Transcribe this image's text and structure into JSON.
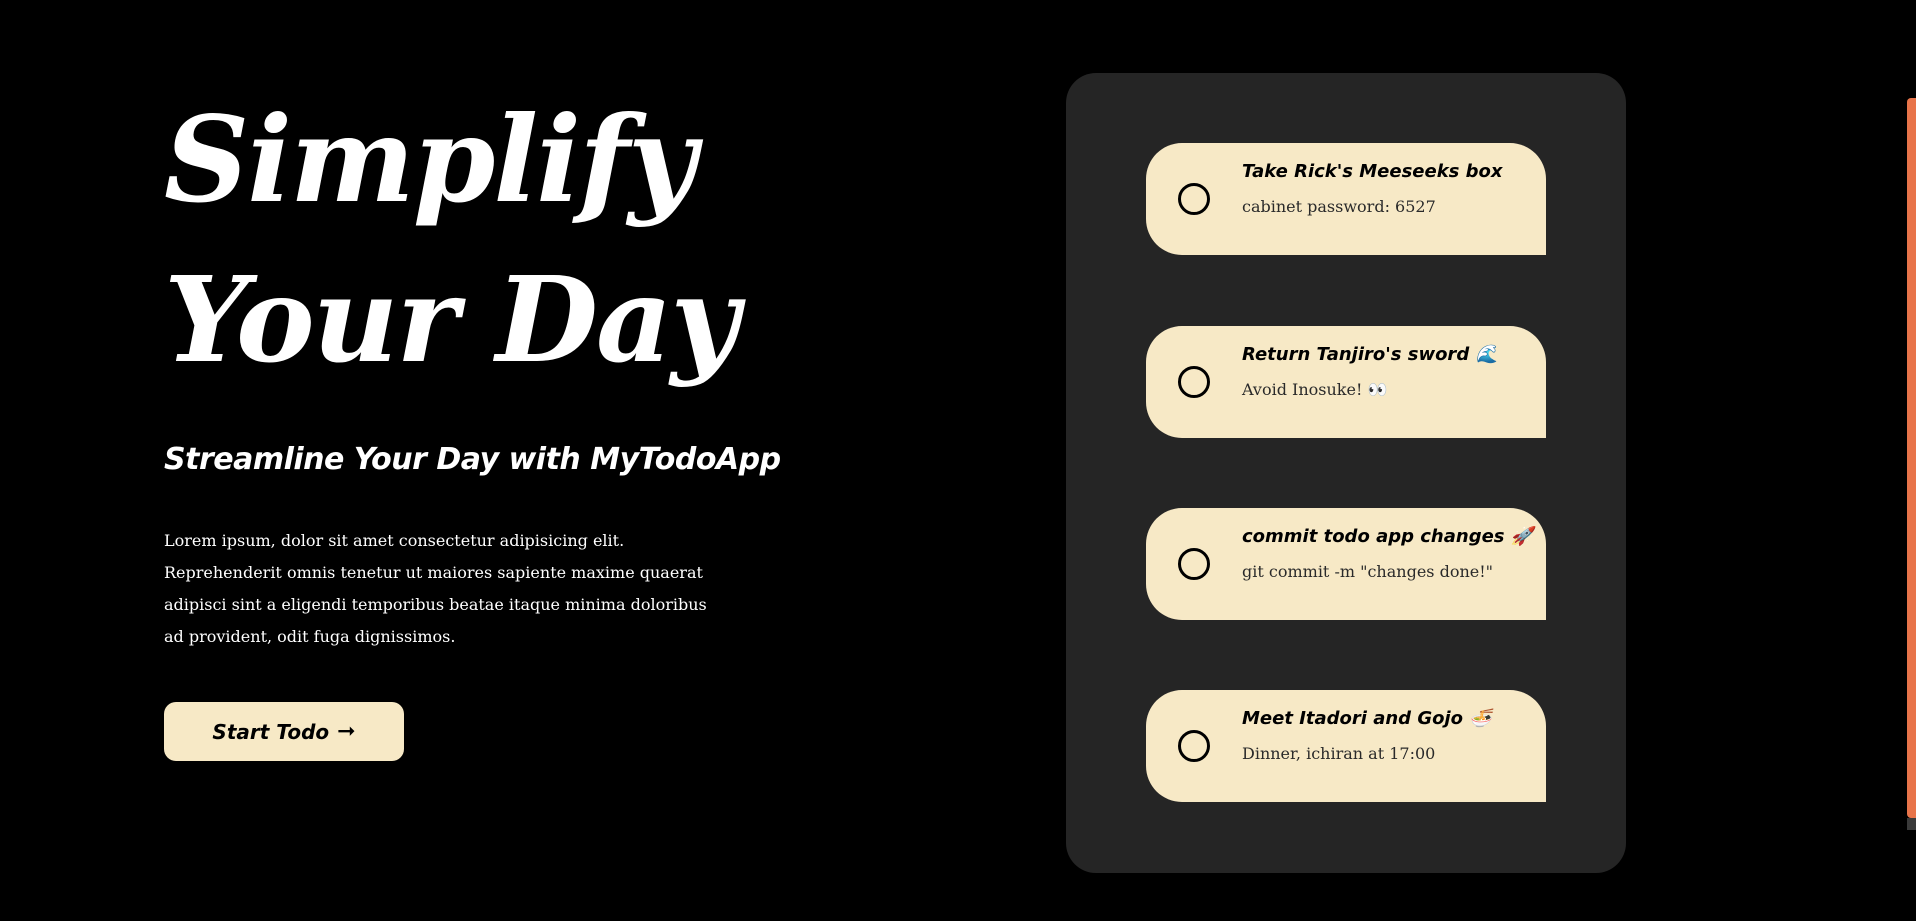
{
  "hero": {
    "title": "Simplify Your Day",
    "subtitle": "Streamline Your Day with MyTodoApp",
    "body": "Lorem ipsum, dolor sit amet consectetur adipisicing elit. Reprehenderit omnis tenetur ut maiores sapiente maxime quaerat adipisci sint a eligendi temporibus beatae itaque minima doloribus ad provident, odit fuga dignissimos.",
    "cta_label": "Start Todo",
    "cta_icon": "arrow-right-icon",
    "cta_arrow": "➞"
  },
  "todos": [
    {
      "title": "Take Rick's Meeseeks box",
      "description": "cabinet password: 6527",
      "done": false
    },
    {
      "title": "Return Tanjiro's sword 🌊",
      "description": "Avoid Inosuke! 👀",
      "done": false
    },
    {
      "title": "commit todo app changes 🚀",
      "description": "git commit -m \"changes done!\"",
      "done": false
    },
    {
      "title": "Meet Itadori and Gojo 🍜",
      "description": "Dinner, ichiran at 17:00",
      "done": false
    }
  ],
  "colors": {
    "background": "#000000",
    "panel": "#252525",
    "card": "#f7e9c6",
    "text_light": "#ffffff",
    "text_dark": "#000000",
    "scrollbar_thumb": "#e8744a"
  }
}
